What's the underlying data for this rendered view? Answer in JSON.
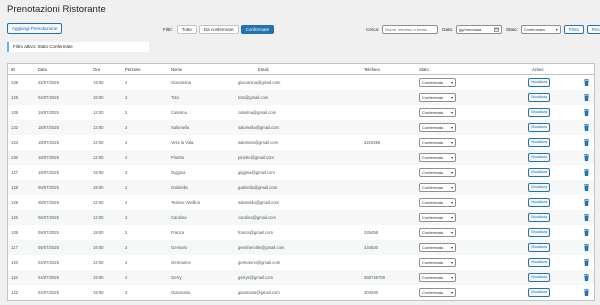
{
  "header": {
    "title": "Prenotazioni Ristorante",
    "add_label": "Aggiungi Prenotazione"
  },
  "filters": {
    "label": "Filtri:",
    "buttons": [
      "Tutte",
      "Da confermare",
      "Confermate"
    ],
    "active": "Confermate"
  },
  "search": {
    "label": "Cerca:",
    "placeholder": "Nome, telefono o email...",
    "date_label": "Data:",
    "date_placeholder": "gg/mm/aaaa",
    "status_label": "Stato:",
    "status_value": "Confermata",
    "filter_btn": "Filtra",
    "reset_btn": "Reset"
  },
  "notice": "Filtro attivo: Stato Confermate",
  "table": {
    "columns": [
      "ID",
      "Data",
      "Ora",
      "Persone",
      "Nome",
      "Email",
      "Telefono",
      "Stato",
      "Azioni"
    ],
    "action_label": "Visualizza",
    "rows": [
      {
        "id": "139",
        "date": "25/07/2025",
        "time": "19:00",
        "people": "2",
        "name": "Giacomina",
        "email": "giacomina@gmail.com",
        "phone": "",
        "status": "Confermata"
      },
      {
        "id": "129",
        "date": "04/07/2025",
        "time": "19:00",
        "people": "2",
        "name": "Toto",
        "email": "toto@gmail.com",
        "phone": "",
        "status": "Confermata"
      },
      {
        "id": "135",
        "date": "18/07/2025",
        "time": "12:00",
        "people": "2",
        "name": "Caterina",
        "email": "caterina@gmail.com",
        "phone": "",
        "status": "Confermata"
      },
      {
        "id": "132",
        "date": "18/07/2025",
        "time": "12:00",
        "people": "2",
        "name": "Salomella",
        "email": "salomella@gmail.com",
        "phone": "",
        "status": "Confermata"
      },
      {
        "id": "133",
        "date": "18/07/2025",
        "time": "12:00",
        "people": "2",
        "name": "Vera la Vida",
        "email": "salomela@gmail.com",
        "phone": "3219456",
        "status": "Confermata"
      },
      {
        "id": "130",
        "date": "18/07/2025",
        "time": "12:00",
        "people": "2",
        "name": "Pinetto",
        "email": "pinetto@gmail.com",
        "phone": "",
        "status": "Confermata"
      },
      {
        "id": "127",
        "date": "18/07/2025",
        "time": "19:00",
        "people": "2",
        "name": "Giggina",
        "email": "giggina@gmail.com",
        "phone": "",
        "status": "Confermata"
      },
      {
        "id": "128",
        "date": "06/07/2025",
        "time": "19:00",
        "people": "2",
        "name": "Gabriella",
        "email": "gabriella@gmail.com",
        "phone": "",
        "status": "Confermata"
      },
      {
        "id": "129",
        "date": "06/07/2025",
        "time": "12:00",
        "people": "2",
        "name": "Testino Vitellino",
        "email": "salamella@gmail.com",
        "phone": "",
        "status": "Confermata"
      },
      {
        "id": "126",
        "date": "06/07/2025",
        "time": "12:00",
        "people": "2",
        "name": "Carolina",
        "email": "carolina@gmail.com",
        "phone": "",
        "status": "Confermata"
      },
      {
        "id": "135",
        "date": "05/07/2025",
        "time": "19:00",
        "people": "2",
        "name": "Franca",
        "email": "franca@gmail.com",
        "phone": "345456",
        "status": "Confermata"
      },
      {
        "id": "117",
        "date": "05/07/2025",
        "time": "19:00",
        "people": "2",
        "name": "Gennaro",
        "email": "gennherotlle@gmail.com",
        "phone": "434540",
        "status": "Confermata"
      },
      {
        "id": "120",
        "date": "04/07/2025",
        "time": "12:00",
        "people": "2",
        "name": "Germanno",
        "email": "germanno@gmail.com",
        "phone": "",
        "status": "Confermata"
      },
      {
        "id": "119",
        "date": "04/07/2025",
        "time": "19:00",
        "people": "2",
        "name": "Gerry",
        "email": "gerrys@gmail.com",
        "phone": "366746700",
        "status": "Confermata"
      },
      {
        "id": "122",
        "date": "04/07/2025",
        "time": "19:00",
        "people": "2",
        "name": "Gianmaria",
        "email": "gianmaria@gmail.com",
        "phone": "404040",
        "status": "Confermata"
      }
    ]
  },
  "colors": {
    "accent": "#2271b1",
    "notice_border": "#72aee6"
  }
}
